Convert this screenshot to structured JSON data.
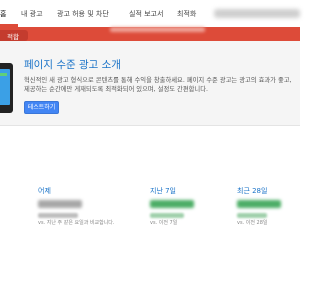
{
  "nav": {
    "items": [
      "홈",
      "내 광고",
      "광고 허용 및 차단",
      "실적 보고서",
      "최적화"
    ]
  },
  "notification": {
    "tab_label": "적합"
  },
  "promo": {
    "title": "페이지 수준 광고 소개",
    "description_line1": "혁신적인 새 광고 형식으로 콘텐츠를 통해 수익을 창출하세요. 페이지 수준 광고는 광고의 효과가 좋고,",
    "description_line2": "제공하는 순간에만 게재되도록 최적화되어 있으며, 설정도 간편합니다.",
    "button_label": "테스트하기"
  },
  "stats": [
    {
      "label": "어제",
      "compare": "vs. 지난 주 같은 요일과 비교합니다."
    },
    {
      "label": "지난 7일",
      "compare": "vs. 이전 7일"
    },
    {
      "label": "최근 28일",
      "compare": "vs. 이전 28일"
    }
  ],
  "colors": {
    "accent_red": "#dd4b39",
    "link_blue": "#1a73c8",
    "button_blue": "#4285f4",
    "positive_green": "#34a853"
  }
}
